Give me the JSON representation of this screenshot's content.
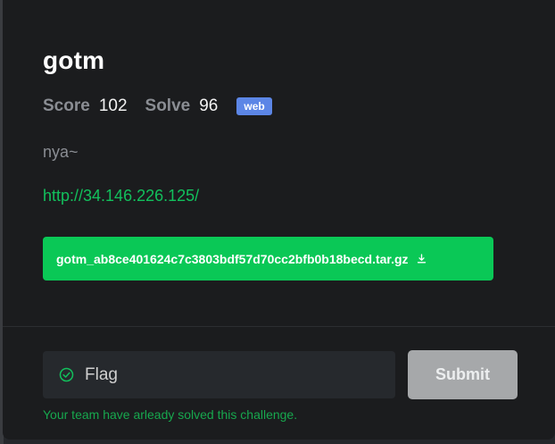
{
  "challenge": {
    "title": "gotm",
    "score_label": "Score",
    "score_value": "102",
    "solve_label": "Solve",
    "solve_value": "96",
    "tag": "web",
    "description": "nya~",
    "link": "http://34.146.226.125/",
    "attachment": "gotm_ab8ce401624c7c3803bdf57d70cc2bfb0b18becd.tar.gz"
  },
  "icons": {
    "attachment": "download-icon",
    "flag_status": "check-circle-icon"
  },
  "form": {
    "flag_placeholder": "Flag",
    "flag_value": "",
    "submit_label": "Submit"
  },
  "status": {
    "message": "Your team have arleady solved this challenge."
  },
  "colors": {
    "accent_green": "#0ac856",
    "tag_blue": "#5c86e6",
    "submit_disabled": "#a6a8aa"
  }
}
